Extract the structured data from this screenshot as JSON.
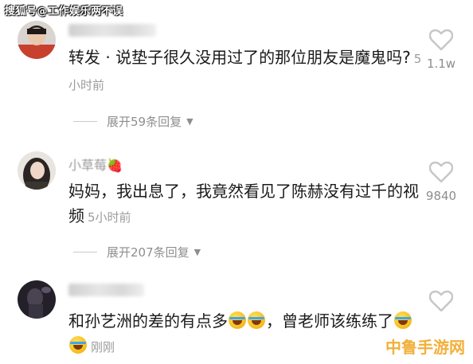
{
  "watermarks": {
    "top": "搜狐号@工作娱乐两不误",
    "bottom": "中鲁手游网"
  },
  "comments": [
    {
      "username": "",
      "body": "转发 · 说垫子很久没用过了的那位朋友是魔鬼吗?",
      "time": "5小时前",
      "likes": "1.1w",
      "expand": "展开59条回复"
    },
    {
      "username": "小草莓🍓",
      "body": "妈妈，我出息了，我竟然看见了陈赫没有过千的视频",
      "time": "5小时前",
      "likes": "9840",
      "expand": "展开207条回复"
    },
    {
      "username": "",
      "body_part1": "和孙艺洲的差的有点多",
      "body_part2": "，曾老师该练练了",
      "time": "刚刚",
      "likes": ""
    }
  ],
  "icons": {
    "like": "heart-outline-icon",
    "expand": "caret-down-icon",
    "emoji": "tears-of-joy-emoji-icon"
  },
  "colors": {
    "text": "#1a1a1a",
    "meta": "#9c9c9c",
    "watermark_bottom": "#f2b03a"
  }
}
